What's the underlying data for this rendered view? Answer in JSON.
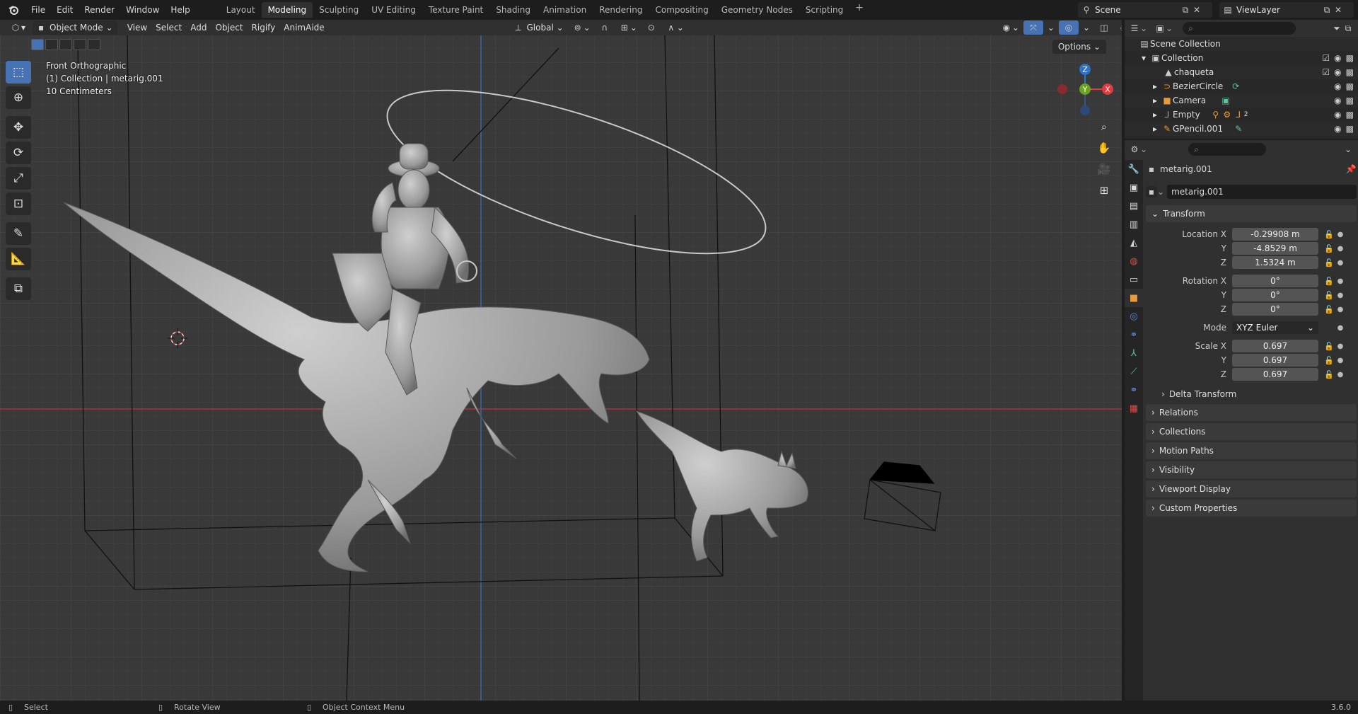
{
  "menu": {
    "items": [
      "File",
      "Edit",
      "Render",
      "Window",
      "Help"
    ]
  },
  "workspaces": {
    "tabs": [
      "Layout",
      "Modeling",
      "Sculpting",
      "UV Editing",
      "Texture Paint",
      "Shading",
      "Animation",
      "Rendering",
      "Compositing",
      "Geometry Nodes",
      "Scripting"
    ],
    "active": "Modeling"
  },
  "scene": {
    "name": "Scene",
    "view_layer": "ViewLayer"
  },
  "viewport": {
    "mode": "Object Mode",
    "menus": [
      "View",
      "Select",
      "Add",
      "Object",
      "Rigify",
      "AnimAide"
    ],
    "transform_orientation": "Global",
    "options_label": "Options",
    "overlay_view": "Front Orthographic",
    "overlay_collection": "(1) Collection | metarig.001",
    "overlay_scale": "10 Centimeters",
    "gizmo_axes": {
      "x": "X",
      "y": "Y",
      "z": "Z"
    }
  },
  "outliner": {
    "root": "Scene Collection",
    "collection": "Collection",
    "items": [
      {
        "name": "chaqueta",
        "icon": "mesh-icon"
      },
      {
        "name": "BezierCircle",
        "icon": "curve-icon"
      },
      {
        "name": "Camera",
        "icon": "camera-icon"
      },
      {
        "name": "Empty",
        "icon": "empty-icon",
        "badge": "2"
      },
      {
        "name": "GPencil.001",
        "icon": "gpencil-icon"
      }
    ]
  },
  "properties": {
    "object_name": "metarig.001",
    "data_name": "metarig.001",
    "transform_label": "Transform",
    "location": {
      "label": "Location X",
      "x": "-0.29908 m",
      "y": "-4.8529 m",
      "z": "1.5324 m"
    },
    "rotation": {
      "label": "Rotation X",
      "x": "0°",
      "y": "0°",
      "z": "0°"
    },
    "mode": {
      "label": "Mode",
      "value": "XYZ Euler"
    },
    "scale": {
      "label": "Scale X",
      "x": "0.697",
      "y": "0.697",
      "z": "0.697"
    },
    "axis_labels": {
      "y": "Y",
      "z": "Z"
    },
    "delta_transform": "Delta Transform",
    "panels": [
      "Relations",
      "Collections",
      "Motion Paths",
      "Visibility",
      "Viewport Display",
      "Custom Properties"
    ]
  },
  "statusbar": {
    "select": "Select",
    "rotate": "Rotate View",
    "context_menu": "Object Context Menu",
    "version": "3.6.0"
  },
  "colors": {
    "accent": "#4772b3",
    "x_axis": "#e2383f",
    "y_axis": "#6ba31f",
    "z_axis": "#2f72c9",
    "viewport_bg": "#393939"
  }
}
